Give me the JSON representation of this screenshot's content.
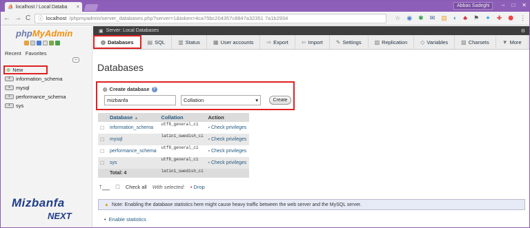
{
  "browser": {
    "tab_title": "localhost / Local Databa",
    "tab_close": "×",
    "user": "Abbas Sadeghi",
    "win_buttons": [
      "–",
      "□",
      "✕"
    ],
    "url_host": "localhost",
    "url_path": "/phpmyadmin/server_databases.php?server=1&token=4ca75bc204357c8847a32351 7a1b2934",
    "nav": [
      "←",
      "→",
      "C"
    ]
  },
  "nav_panel": {
    "recent": "Recent",
    "favorites": "Favorites",
    "collapse": "⊖",
    "tree": [
      {
        "label": "New"
      },
      {
        "label": "information_schema"
      },
      {
        "label": "mysql"
      },
      {
        "label": "performance_schema"
      },
      {
        "label": "sys"
      }
    ],
    "brand_line1": "Mizbanfa",
    "brand_line2": "NEXT"
  },
  "breadcrumb": {
    "text": "Server: Local Databases",
    "corner": "⚙"
  },
  "menu": [
    {
      "label": "Databases",
      "icon": "database-icon"
    },
    {
      "label": "SQL",
      "icon": "sql-icon"
    },
    {
      "label": "Status",
      "icon": "status-icon"
    },
    {
      "label": "User accounts",
      "icon": "user-accounts-icon"
    },
    {
      "label": "Export",
      "icon": "export-icon"
    },
    {
      "label": "Import",
      "icon": "import-icon"
    },
    {
      "label": "Settings",
      "icon": "settings-icon"
    },
    {
      "label": "Replication",
      "icon": "replication-icon"
    },
    {
      "label": "Variables",
      "icon": "variables-icon"
    },
    {
      "label": "Charsets",
      "icon": "charsets-icon"
    },
    {
      "label": "More",
      "icon": "more-icon"
    }
  ],
  "page_title": "Databases",
  "create": {
    "label": "Create database",
    "name_value": "mizbanfa",
    "collation_value": "Collation",
    "button": "Create"
  },
  "table": {
    "headers": [
      "Database",
      "Collation",
      "Action"
    ],
    "sort_indicator": "▲",
    "rows": [
      {
        "db": "information_schema",
        "collation": "utf8_general_ci",
        "action": "Check privileges"
      },
      {
        "db": "mysql",
        "collation": "latin1_swedish_ci",
        "action": "Check privileges"
      },
      {
        "db": "performance_schema",
        "collation": "utf8_general_ci",
        "action": "Check privileges"
      },
      {
        "db": "sys",
        "collation": "utf8_general_ci",
        "action": "Check privileges"
      }
    ],
    "total_label": "Total: 4",
    "total_collation": "latin1_swedish_ci"
  },
  "bottom": {
    "check_all": "Check all",
    "with_selected": "With selected:",
    "drop": "Drop"
  },
  "note": "Note: Enabling the database statistics here might cause heavy traffic between the web server and the MySQL server.",
  "enable_stats": "Enable statistics",
  "colors": {
    "accent_red": "#e02020",
    "titlebar": "#8e5fb8",
    "link": "#235a81"
  }
}
